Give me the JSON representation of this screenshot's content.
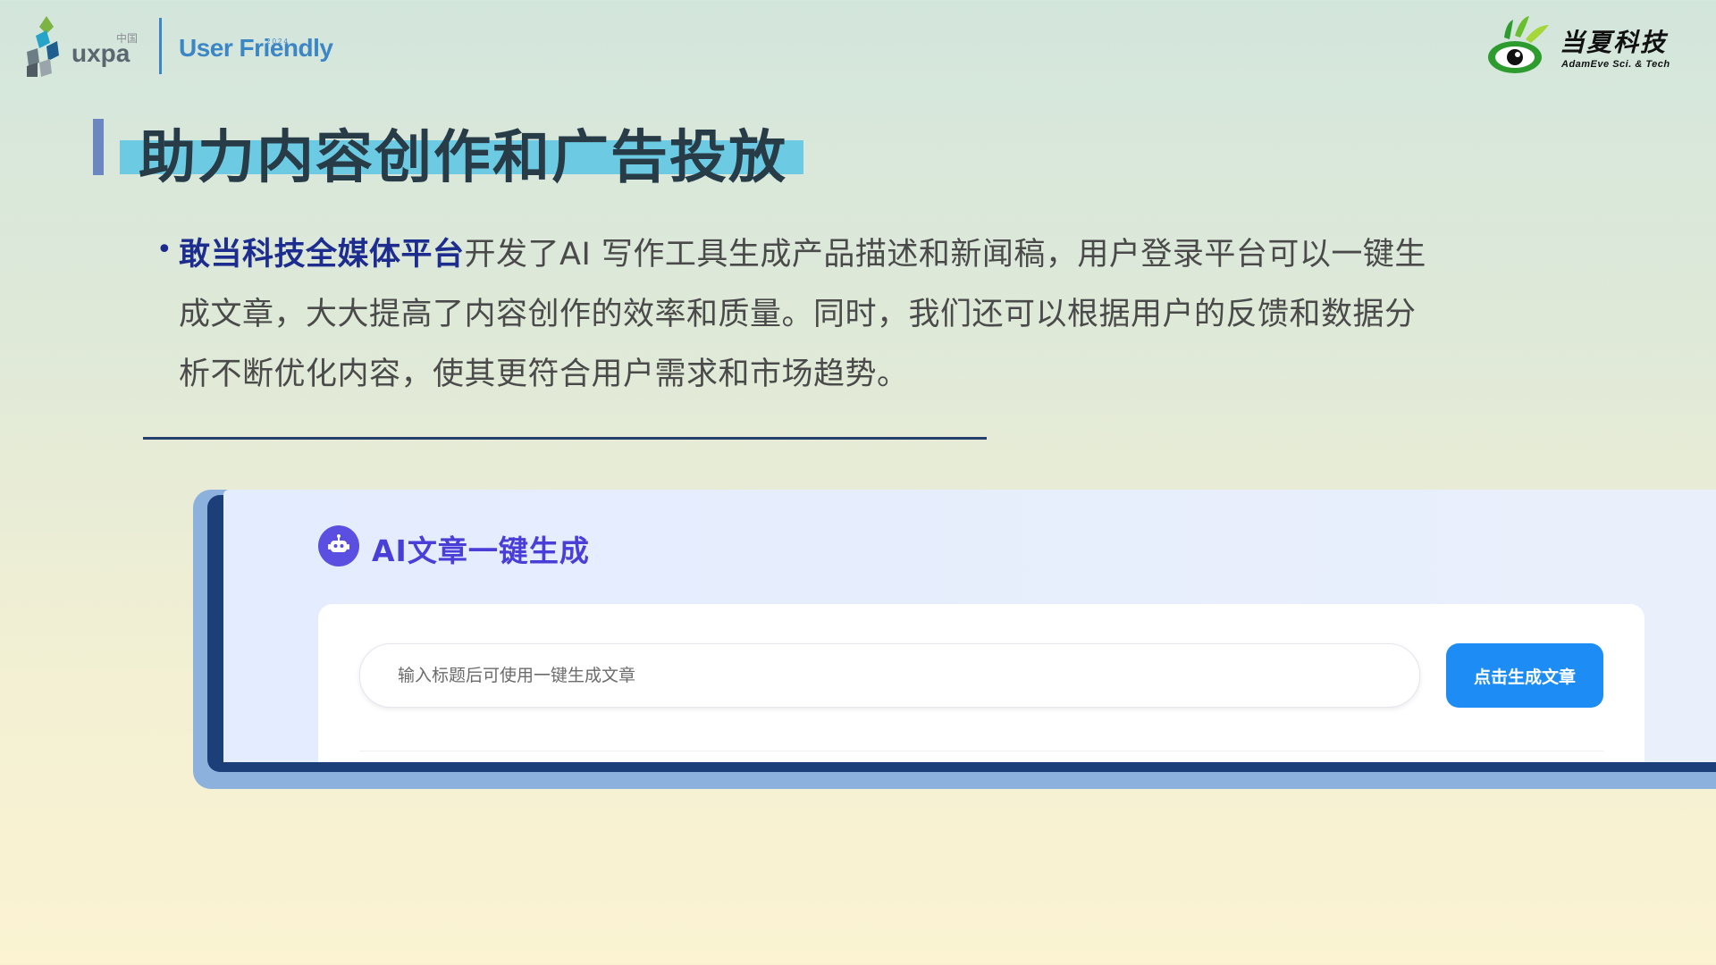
{
  "header": {
    "uxpa_text": "uxpa",
    "uxpa_cn": "中国",
    "uf_text": "User Friendly",
    "uf_year": "2024",
    "brand_cn": "当夏科技",
    "brand_en": "AdamEve Sci. & Tech"
  },
  "slide": {
    "title": "助力内容创作和广告投放",
    "bullet": "•",
    "para_highlight": "敢当科技全媒体平台",
    "para_body": "开发了AI 写作工具生成产品描述和新闻稿，用户登录平台可以一键生成文章，大大提高了内容创作的效率和质量。同时，我们还可以根据用户的反馈和数据分析不断优化内容，使其更符合用户需求和市场趋势。"
  },
  "app": {
    "heading": "AI文章一键生成",
    "input_value": "",
    "input_placeholder": "输入标题后可使用一键生成文章",
    "button_label": "点击生成文章"
  },
  "colors": {
    "accent_blue": "#1e8cf5",
    "heading_purple": "#4a3ed8",
    "title_highlight": "#6ccbe3",
    "brand_green": "#2e9b2f"
  }
}
